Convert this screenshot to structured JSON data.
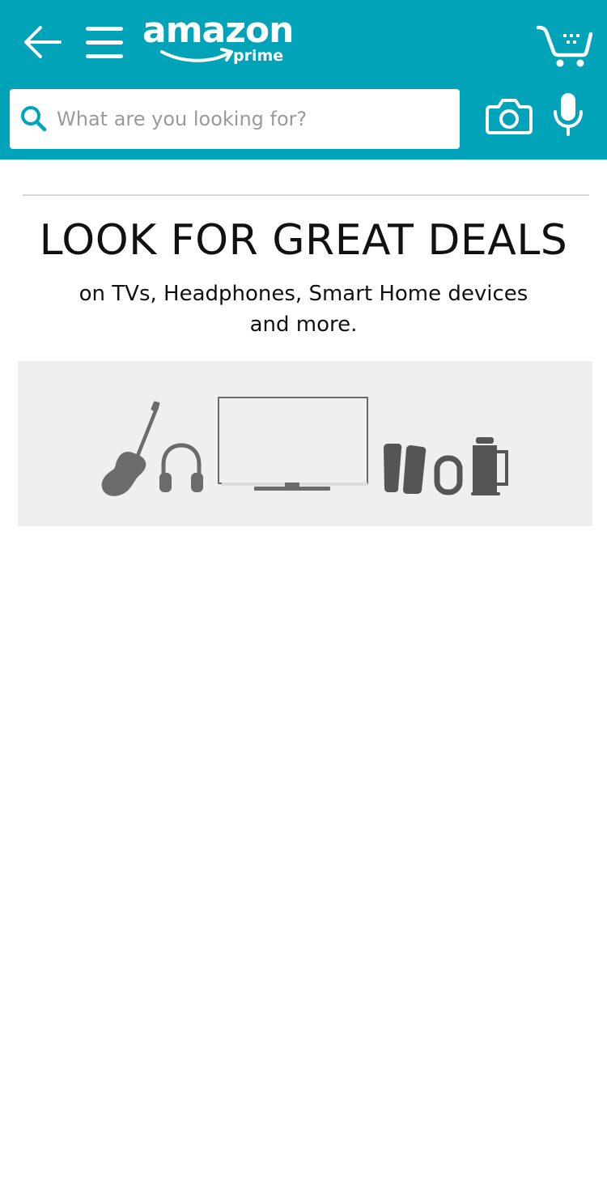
{
  "header": {
    "logo_text": "amazon",
    "logo_sub": "prime",
    "brand_color": "#00a3b8",
    "icons": {
      "back": "arrow-left-icon",
      "menu": "hamburger-menu-icon",
      "cart": "cart-icon",
      "camera": "camera-icon",
      "mic": "microphone-icon",
      "search": "search-icon"
    }
  },
  "search": {
    "placeholder": "What are you looking for?",
    "value": ""
  },
  "main": {
    "headline": "LOOK FOR GREAT DEALS",
    "subline_1": "on TVs, Headphones, Smart Home devices",
    "subline_2": "and more.",
    "banner_items": [
      "guitar-icon",
      "headphones-icon",
      "tv-icon",
      "speakers-icon",
      "fitness-band-icon",
      "coffee-maker-icon"
    ]
  }
}
